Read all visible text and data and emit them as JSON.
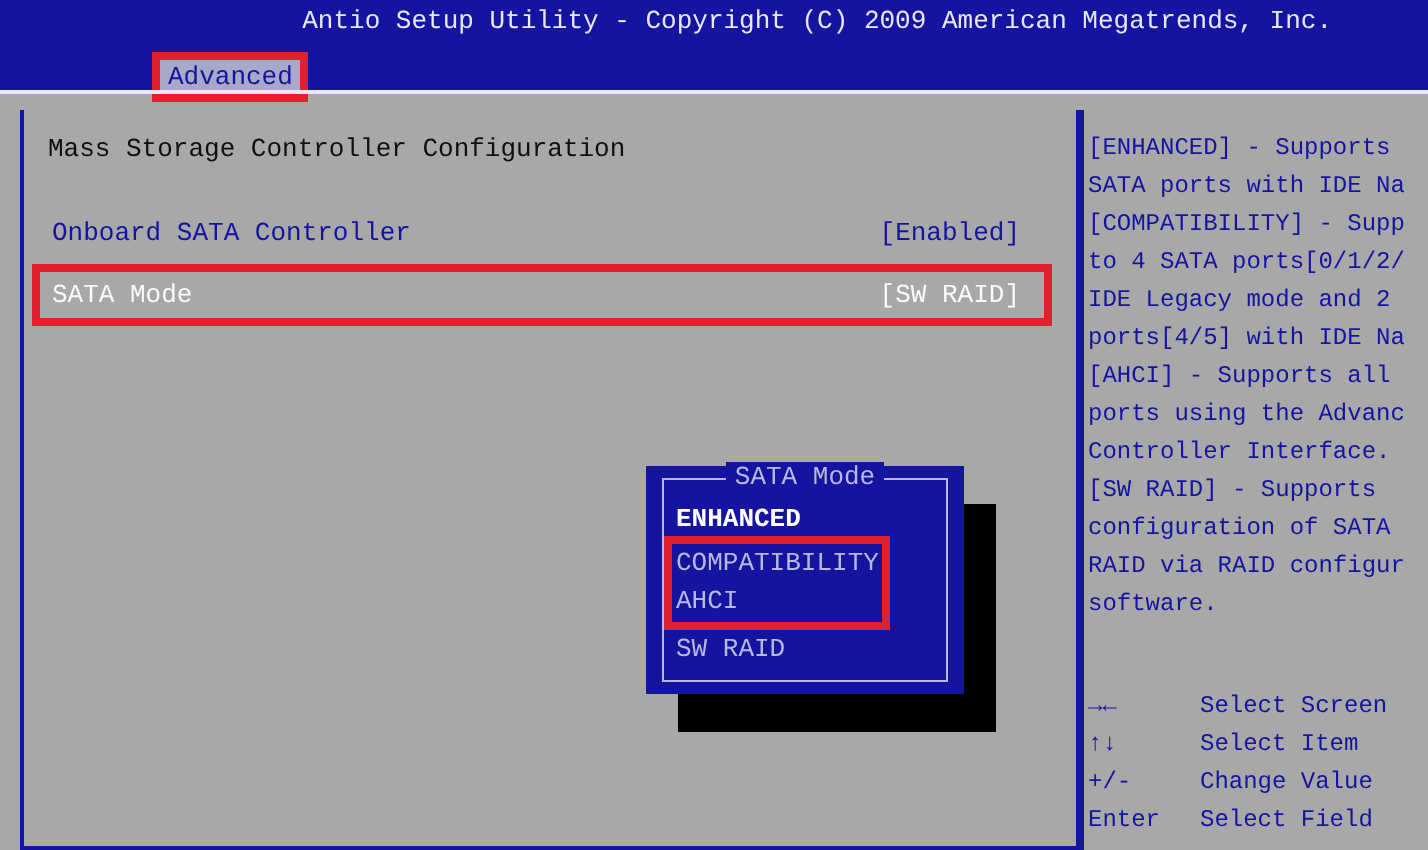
{
  "window": {
    "title": "Antio Setup Utility - Copyright (C) 2009 American Megatrends, Inc."
  },
  "tabs": [
    {
      "label": "Advanced",
      "selected": true,
      "annotated": true
    }
  ],
  "panel": {
    "heading": "Mass Storage Controller Configuration",
    "items": [
      {
        "label": "Onboard SATA Controller",
        "value": "[Enabled]",
        "selected": false,
        "annotated": false
      },
      {
        "label": "SATA Mode",
        "value": "[SW RAID]",
        "selected": true,
        "annotated": true
      }
    ]
  },
  "popup": {
    "title": "SATA Mode",
    "options": [
      {
        "label": "ENHANCED",
        "selected": true,
        "annotated": false
      },
      {
        "label": "COMPATIBILITY",
        "selected": false,
        "annotated": true
      },
      {
        "label": "AHCI",
        "selected": false,
        "annotated": true
      },
      {
        "label": "SW RAID",
        "selected": false,
        "annotated": false
      }
    ]
  },
  "help": {
    "lines": [
      "[ENHANCED] - Supports",
      "SATA ports with IDE Na",
      "[COMPATIBILITY] - Supp",
      "to 4 SATA ports[0/1/2/",
      "IDE Legacy mode and 2",
      "ports[4/5] with IDE Na",
      "[AHCI] - Supports all",
      "ports using the Advanc",
      "Controller Interface.",
      "[SW RAID] - Supports",
      "configuration of SATA",
      "RAID via RAID configur",
      "software."
    ],
    "keys": [
      {
        "key": "→←",
        "action": "Select Screen"
      },
      {
        "key": "↑↓",
        "action": "Select Item"
      },
      {
        "key": "+/-",
        "action": "Change Value"
      },
      {
        "key": "Enter",
        "action": "Select Field"
      }
    ]
  }
}
